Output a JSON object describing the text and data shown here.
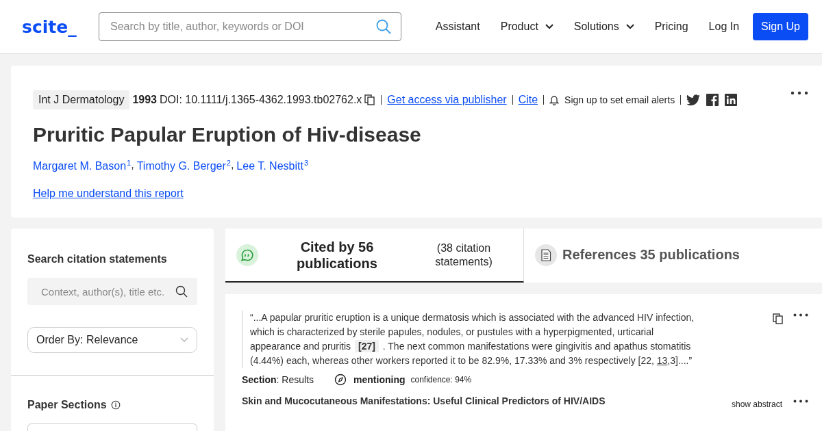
{
  "header": {
    "logo": "scite_",
    "search": {
      "placeholder": "Search by title, author, keywords or DOI"
    },
    "nav": [
      {
        "label": "Assistant",
        "dropdown": false
      },
      {
        "label": "Product",
        "dropdown": true
      },
      {
        "label": "Solutions",
        "dropdown": true
      },
      {
        "label": "Pricing",
        "dropdown": false
      },
      {
        "label": "Log In",
        "dropdown": false
      }
    ],
    "signup": "Sign Up"
  },
  "article": {
    "journal": "Int J Dermatology",
    "year": "1993",
    "doi": "DOI: 10.1111/j.1365-4362.1993.tb02762.x",
    "access_link": "Get access via publisher",
    "cite_link": "Cite",
    "alerts": "Sign up to set email alerts",
    "title": "Pruritic Papular Eruption of Hiv-disease",
    "authors": [
      {
        "name": "Margaret M. Bason",
        "mark": "1",
        "separator": ","
      },
      {
        "name": "Timothy G. Berger",
        "mark": "2",
        "separator": ","
      },
      {
        "name": "Lee T. Nesbitt",
        "mark": "3"
      }
    ],
    "help_link": "Help me understand this report"
  },
  "sidebar": {
    "search_heading": "Search citation statements",
    "search": {
      "placeholder": "Context, author(s), title etc."
    },
    "order_by": "Order By: Relevance",
    "sections_heading": "Paper Sections"
  },
  "tabs": [
    {
      "kind": "cited",
      "label": "Cited by 56 publications",
      "note": "(38 citation statements)",
      "selected": true
    },
    {
      "kind": "references",
      "label": "References 35 publications",
      "selected": false
    }
  ],
  "citation": {
    "quote": [
      {
        "kind": "text",
        "text": "“...A papular pruritic eruption is a unique dermatosis which is associated with the advanced HIV infection, which is characterized by sterile papules, nodules, or pustules with a hyperpigmented, urticarial appearance and pruritis "
      },
      {
        "kind": "ref",
        "text": "[27]"
      },
      {
        "kind": "text",
        "text": " . The next common manifestations were gingivitis and apathus stomatitis (4.44%) each, whereas other workers reported it to be 82.9%, 17.33% and 3% respectively [22, "
      },
      {
        "kind": "link",
        "text": "13"
      },
      {
        "kind": "text",
        "text": ",3]....”"
      }
    ],
    "section_label": "Section",
    "section": ": Results",
    "type": "mentioning",
    "confidence": "confidence: 94%",
    "paper_title": "Skin and Mucocutaneous Manifestations: Useful Clinical Predictors of HIV/AIDS",
    "show_abstract": "show abstract"
  }
}
